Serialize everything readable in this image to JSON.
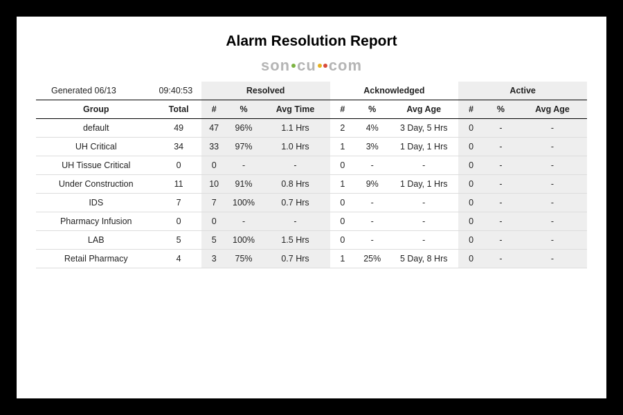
{
  "report": {
    "title": "Alarm Resolution Report",
    "logo": {
      "left": "son",
      "mid": "cu",
      "right": "com"
    },
    "generated_label": "Generated 06/13",
    "generated_time": "09:40:53",
    "sections": {
      "resolved": "Resolved",
      "acknowledged": "Acknowledged",
      "active": "Active"
    },
    "headers": {
      "group": "Group",
      "total": "Total",
      "count": "#",
      "pct": "%",
      "avg_time": "Avg Time",
      "avg_age": "Avg Age"
    },
    "rows": [
      {
        "group": "default",
        "total": "49",
        "res_n": "47",
        "res_pct": "96%",
        "res_time": "1.1 Hrs",
        "ack_n": "2",
        "ack_pct": "4%",
        "ack_age": "3 Day, 5 Hrs",
        "act_n": "0",
        "act_pct": "-",
        "act_age": "-"
      },
      {
        "group": "UH Critical",
        "total": "34",
        "res_n": "33",
        "res_pct": "97%",
        "res_time": "1.0 Hrs",
        "ack_n": "1",
        "ack_pct": "3%",
        "ack_age": "1 Day, 1 Hrs",
        "act_n": "0",
        "act_pct": "-",
        "act_age": "-"
      },
      {
        "group": "UH Tissue Critical",
        "total": "0",
        "res_n": "0",
        "res_pct": "-",
        "res_time": "-",
        "ack_n": "0",
        "ack_pct": "-",
        "ack_age": "-",
        "act_n": "0",
        "act_pct": "-",
        "act_age": "-"
      },
      {
        "group": "Under Construction",
        "total": "11",
        "res_n": "10",
        "res_pct": "91%",
        "res_time": "0.8 Hrs",
        "ack_n": "1",
        "ack_pct": "9%",
        "ack_age": "1 Day, 1 Hrs",
        "act_n": "0",
        "act_pct": "-",
        "act_age": "-"
      },
      {
        "group": "IDS",
        "total": "7",
        "res_n": "7",
        "res_pct": "100%",
        "res_time": "0.7 Hrs",
        "ack_n": "0",
        "ack_pct": "-",
        "ack_age": "-",
        "act_n": "0",
        "act_pct": "-",
        "act_age": "-"
      },
      {
        "group": "Pharmacy Infusion",
        "total": "0",
        "res_n": "0",
        "res_pct": "-",
        "res_time": "-",
        "ack_n": "0",
        "ack_pct": "-",
        "ack_age": "-",
        "act_n": "0",
        "act_pct": "-",
        "act_age": "-"
      },
      {
        "group": "LAB",
        "total": "5",
        "res_n": "5",
        "res_pct": "100%",
        "res_time": "1.5 Hrs",
        "ack_n": "0",
        "ack_pct": "-",
        "ack_age": "-",
        "act_n": "0",
        "act_pct": "-",
        "act_age": "-"
      },
      {
        "group": "Retail Pharmacy",
        "total": "4",
        "res_n": "3",
        "res_pct": "75%",
        "res_time": "0.7 Hrs",
        "ack_n": "1",
        "ack_pct": "25%",
        "ack_age": "5 Day, 8 Hrs",
        "act_n": "0",
        "act_pct": "-",
        "act_age": "-"
      }
    ]
  }
}
